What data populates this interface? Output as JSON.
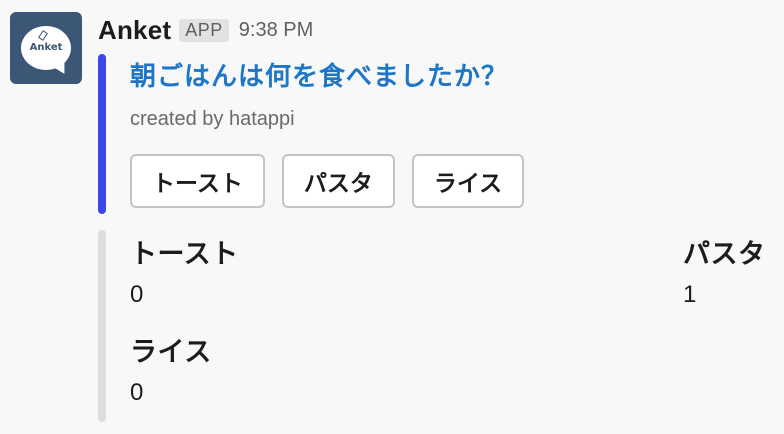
{
  "message": {
    "app_name": "Anket",
    "app_badge": "APP",
    "timestamp": "9:38 PM",
    "avatar_label": "Anket"
  },
  "attachment": {
    "title": "朝ごはんは何を食べましたか？",
    "created_by": "created by hatappi",
    "accent_color": "#3d46e6",
    "buttons": [
      {
        "label": "トースト"
      },
      {
        "label": "パスタ"
      },
      {
        "label": "ライス"
      }
    ]
  },
  "results": {
    "fields": [
      {
        "title": "トースト",
        "value": "0"
      },
      {
        "title": "パスタ",
        "value": "1"
      },
      {
        "title": "ライス",
        "value": "0"
      }
    ]
  },
  "colors": {
    "link": "#1d76c6",
    "results_bar": "#dddddd",
    "avatar_bg": "#3b5775"
  }
}
